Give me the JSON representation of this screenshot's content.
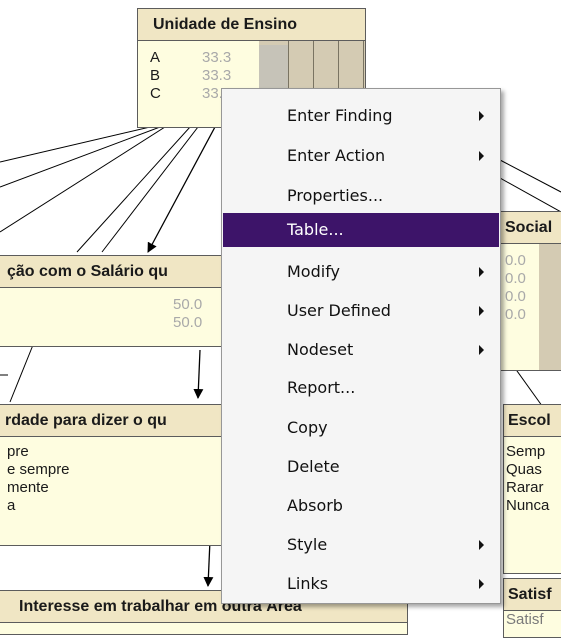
{
  "nodes": {
    "unidade": {
      "title": "Unidade de Ensino",
      "states": [
        {
          "label": "A",
          "value": "33.3"
        },
        {
          "label": "B",
          "value": "33.3"
        },
        {
          "label": "C",
          "value": "33.3"
        }
      ]
    },
    "salario": {
      "title": "ção com o Salário qu",
      "states": [
        {
          "label": "",
          "value": "50.0"
        },
        {
          "label": "",
          "value": "50.0"
        }
      ]
    },
    "social": {
      "title": "Social",
      "states": [
        {
          "value": "0.0"
        },
        {
          "value": "0.0"
        },
        {
          "value": "0.0"
        },
        {
          "value": "0.0"
        }
      ]
    },
    "liberdade": {
      "title": "rdade para dizer o qu",
      "states": [
        {
          "label": "pre"
        },
        {
          "label": "e sempre"
        },
        {
          "label": "mente"
        },
        {
          "label": "a"
        }
      ]
    },
    "escolha": {
      "title": "Escol",
      "states": [
        {
          "label": "Semp"
        },
        {
          "label": "Quas"
        },
        {
          "label": "Rarar"
        },
        {
          "label": "Nunca"
        }
      ]
    },
    "interesse": {
      "title": "Interesse em trabalhar em outra Área"
    },
    "satisfacao": {
      "title": "Satisf",
      "states": [
        {
          "label": "Satisf"
        }
      ]
    }
  },
  "context_menu": {
    "items": [
      {
        "label": "Enter Finding",
        "submenu": true,
        "highlighted": false
      },
      {
        "label": "Enter Action",
        "submenu": true,
        "highlighted": false
      },
      {
        "label": "Properties...",
        "submenu": false,
        "highlighted": false
      },
      {
        "label": "Table...",
        "submenu": false,
        "highlighted": true
      },
      {
        "label": "Modify",
        "submenu": true,
        "highlighted": false
      },
      {
        "label": "User Defined",
        "submenu": true,
        "highlighted": false
      },
      {
        "label": "Nodeset",
        "submenu": true,
        "highlighted": false
      },
      {
        "label": "Report...",
        "submenu": false,
        "highlighted": false
      },
      {
        "label": "Copy",
        "submenu": false,
        "highlighted": false
      },
      {
        "label": "Delete",
        "submenu": false,
        "highlighted": false
      },
      {
        "label": "Absorb",
        "submenu": false,
        "highlighted": false
      },
      {
        "label": "Style",
        "submenu": true,
        "highlighted": false
      },
      {
        "label": "Links",
        "submenu": true,
        "highlighted": false
      }
    ]
  },
  "colors": {
    "node_body": "#fefde0",
    "node_title": "#f0e6c4",
    "highlight": "#3d1469",
    "menu_bg": "#f5f5f5"
  }
}
